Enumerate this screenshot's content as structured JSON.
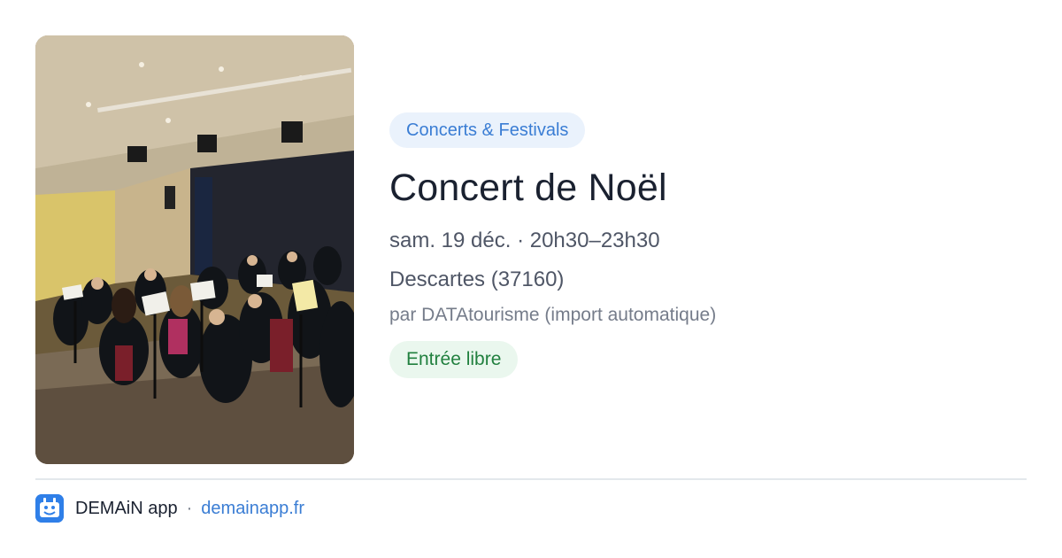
{
  "event": {
    "category": "Concerts & Festivals",
    "title": "Concert de Noël",
    "datetime": "sam. 19 déc. · 20h30–23h30",
    "location": "Descartes (37160)",
    "source": "par DATAtourisme (import automatique)",
    "price": "Entrée libre",
    "photo_icon": "concert-hall-orchestra-photo"
  },
  "footer": {
    "app_name": "DEMAiN app",
    "separator": "·",
    "url": "demainapp.fr",
    "logo_icon": "demain-app-logo"
  },
  "colors": {
    "accent": "#3a7dd4",
    "category_bg": "#eaf2fc",
    "price_text": "#21803f",
    "price_bg": "#eaf7ee",
    "title": "#1a2130",
    "muted": "#4f5666",
    "logo_bg": "#2f7fe8"
  }
}
